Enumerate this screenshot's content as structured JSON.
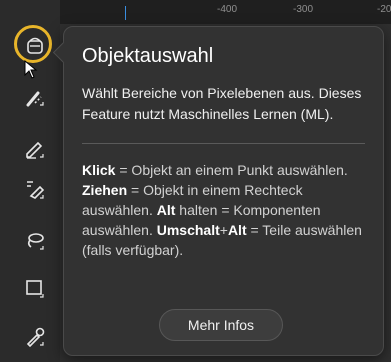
{
  "ruler": {
    "ticks": [
      "-400",
      "-300",
      "-20"
    ]
  },
  "toolbar": {
    "tools": [
      {
        "icon": "object-selection-icon",
        "active": true
      },
      {
        "icon": "brush-remove-icon",
        "active": false
      },
      {
        "icon": "pencil-icon",
        "active": false
      },
      {
        "icon": "eraser-icon",
        "active": false
      },
      {
        "icon": "lasso-icon",
        "active": false
      },
      {
        "icon": "rectangle-icon",
        "active": false
      },
      {
        "icon": "eyedropper-icon",
        "active": false
      }
    ],
    "accent": "#e8b52a"
  },
  "tooltip": {
    "title": "Objektauswahl",
    "description": "Wählt Bereiche von Pixelebenen aus. Dieses Feature nutzt Maschinelles Lernen (ML).",
    "help": {
      "click_key": "Klick",
      "click_text": " = Objekt an einem Punkt auswählen. ",
      "drag_key": "Ziehen",
      "drag_text": " = Objekt in einem Rechteck auswählen. ",
      "alt_key": "Alt",
      "alt_text": " halten = Komponenten auswählen. ",
      "shift_key": "Umschalt",
      "plus": "+",
      "alt_key2": "Alt",
      "parts_text": " = Teile auswählen (falls verfügbar)."
    },
    "more_button": "Mehr Infos"
  }
}
